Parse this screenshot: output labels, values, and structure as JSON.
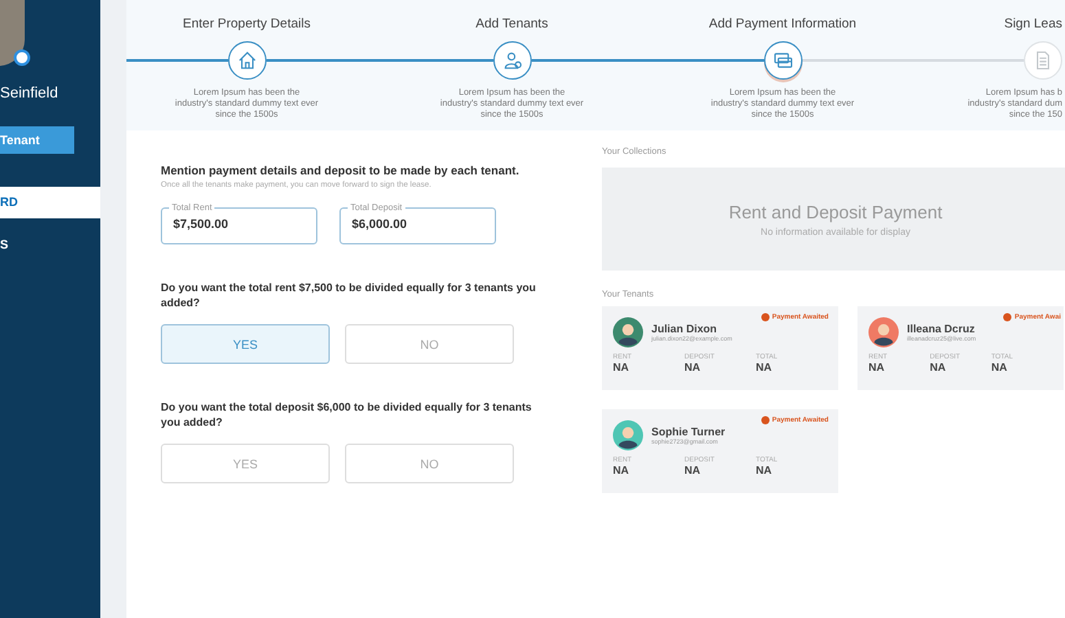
{
  "sidebar": {
    "user_name": "Seinfield",
    "action_button": "Tenant",
    "items": [
      {
        "label": "RD",
        "selected": true
      },
      {
        "label": "S",
        "selected": false
      }
    ]
  },
  "steps": [
    {
      "title": "Enter Property Details",
      "completed": true,
      "selected": false,
      "lines": [
        "Lorem Ipsum has been the",
        "industry's standard dummy text ever",
        "since the 1500s"
      ]
    },
    {
      "title": "Add Tenants",
      "completed": true,
      "selected": false,
      "lines": [
        "Lorem Ipsum has been the",
        "industry's standard dummy text ever",
        "since the 1500s"
      ]
    },
    {
      "title": "Add Payment Information",
      "completed": false,
      "selected": true,
      "lines": [
        "Lorem Ipsum has been the",
        "industry's standard dummy text ever",
        "since the 1500s"
      ]
    },
    {
      "title": "Sign Leas",
      "completed": false,
      "selected": false,
      "lines": [
        "Lorem Ipsum has b",
        "industry's standard dum",
        "since the 150"
      ]
    }
  ],
  "form": {
    "heading": "Mention payment details and deposit to be made by each tenant.",
    "subheading": "Once all the tenants make payment, you can move forward to sign the lease.",
    "fields": [
      {
        "label": "Total Rent",
        "value": "$7,500.00"
      },
      {
        "label": "Total Deposit",
        "value": "$6,000.00"
      }
    ],
    "questions": [
      {
        "text": "Do you want the total rent $7,500 to be divided equally for 3 tenants you added?",
        "options": [
          {
            "label": "YES",
            "selected": true
          },
          {
            "label": "NO",
            "selected": false
          }
        ]
      },
      {
        "text": "Do you want the total deposit $6,000 to be divided equally for 3 tenants you added?",
        "options": [
          {
            "label": "YES",
            "selected": false
          },
          {
            "label": "NO",
            "selected": false
          }
        ]
      }
    ]
  },
  "collections": {
    "label": "Your Collections",
    "title": "Rent and Deposit Payment",
    "message": "No information available for display"
  },
  "tenants": {
    "label": "Your Tenants",
    "cards": [
      {
        "name": "Julian Dixon",
        "email": "julian.dixon22@example.com",
        "status": "Payment Awaited",
        "color": "#3d8a6e",
        "stats": [
          {
            "label": "RENT",
            "value": "NA"
          },
          {
            "label": "DEPOSIT",
            "value": "NA"
          },
          {
            "label": "TOTAL",
            "value": "NA"
          }
        ]
      },
      {
        "name": "Illeana Dcruz",
        "email": "illeanadcruz25@live.com",
        "status": "Payment Awai",
        "color": "#ef7a64",
        "stats": [
          {
            "label": "RENT",
            "value": "NA"
          },
          {
            "label": "DEPOSIT",
            "value": "NA"
          },
          {
            "label": "TOTAL",
            "value": "NA"
          }
        ]
      },
      {
        "name": "Sophie Turner",
        "email": "sophie2723@gmail.com",
        "status": "Payment Awaited",
        "color": "#4fc6b4",
        "stats": [
          {
            "label": "RENT",
            "value": "NA"
          },
          {
            "label": "DEPOSIT",
            "value": "NA"
          },
          {
            "label": "TOTAL",
            "value": "NA"
          }
        ]
      }
    ]
  }
}
